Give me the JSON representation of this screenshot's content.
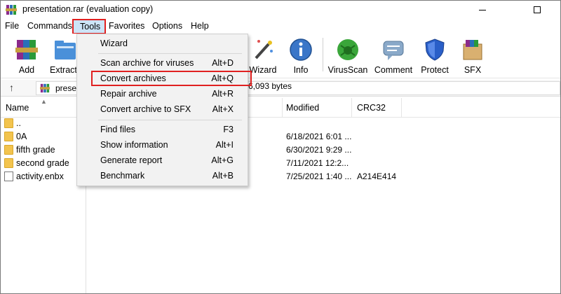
{
  "window": {
    "title": "presentation.rar (evaluation copy)"
  },
  "menubar": [
    "File",
    "Commands",
    "Tools",
    "Favorites",
    "Options",
    "Help"
  ],
  "toolbar": [
    {
      "label": "Add",
      "icon": "add-archive-icon"
    },
    {
      "label": "Extract To",
      "icon": "extract-icon"
    },
    {
      "label": "Wizard",
      "icon": "wizard-wand-icon"
    },
    {
      "label": "Info",
      "icon": "info-icon"
    },
    {
      "label": "VirusScan",
      "icon": "virus-scan-icon"
    },
    {
      "label": "Comment",
      "icon": "comment-icon"
    },
    {
      "label": "Protect",
      "icon": "shield-icon"
    },
    {
      "label": "SFX",
      "icon": "sfx-box-icon"
    }
  ],
  "address": {
    "path": "prese",
    "info": "6,093 bytes"
  },
  "columns": {
    "name": "Name",
    "modified": "Modified",
    "crc": "CRC32"
  },
  "files": [
    {
      "name": "..",
      "type": "folder",
      "modified": "",
      "crc": ""
    },
    {
      "name": "0A",
      "type": "folder",
      "modified": "6/18/2021 6:01 ...",
      "crc": ""
    },
    {
      "name": "fifth grade",
      "type": "folder",
      "modified": "6/30/2021 9:29 ...",
      "crc": ""
    },
    {
      "name": "second grade",
      "type": "folder",
      "modified": "7/11/2021 12:2...",
      "crc": ""
    },
    {
      "name": "activity.enbx",
      "type": "file",
      "modified": "7/25/2021 1:40 ...",
      "crc": "A214E414"
    }
  ],
  "tools_menu": {
    "items": [
      {
        "label": "Wizard",
        "shortcut": ""
      },
      {
        "label": "Scan archive for viruses",
        "shortcut": "Alt+D"
      },
      {
        "label": "Convert archives",
        "shortcut": "Alt+Q"
      },
      {
        "label": "Repair archive",
        "shortcut": "Alt+R"
      },
      {
        "label": "Convert archive to SFX",
        "shortcut": "Alt+X"
      },
      {
        "label": "Find files",
        "shortcut": "F3"
      },
      {
        "label": "Show information",
        "shortcut": "Alt+I"
      },
      {
        "label": "Generate report",
        "shortcut": "Alt+G"
      },
      {
        "label": "Benchmark",
        "shortcut": "Alt+B"
      }
    ]
  },
  "colors": {
    "highlight_border": "#e02020",
    "menu_hover": "#cce4f7",
    "folder": "#f3c44e"
  }
}
